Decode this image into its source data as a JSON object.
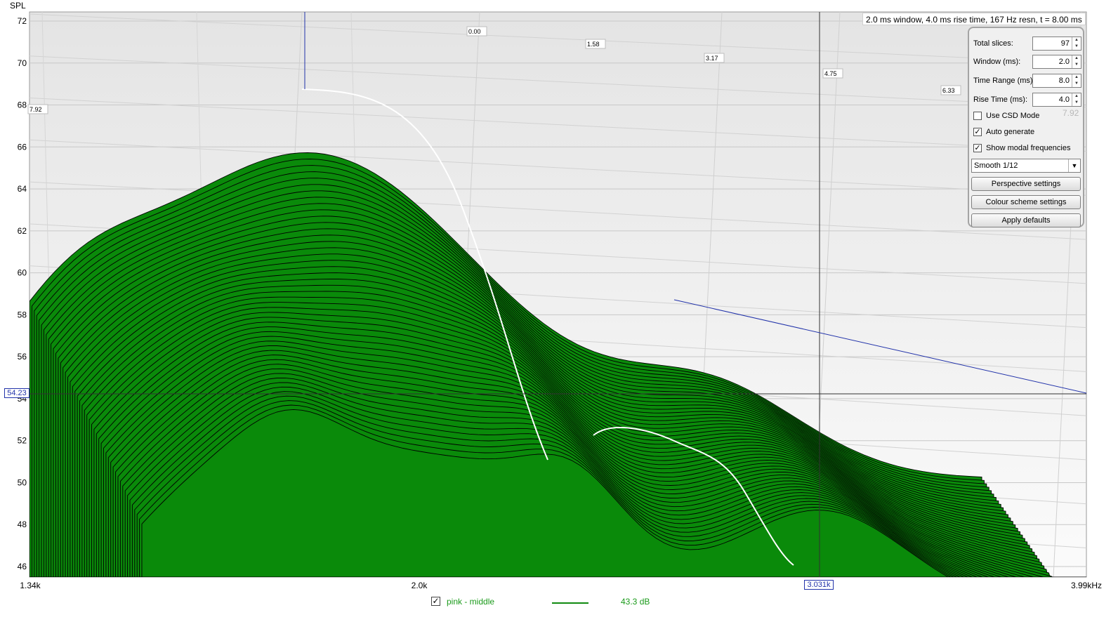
{
  "chart_data": {
    "type": "waterfall",
    "ylabel": "SPL",
    "y_ticks": [
      "72",
      "70",
      "68",
      "66",
      "64",
      "62",
      "60",
      "58",
      "56",
      "54",
      "52",
      "50",
      "48",
      "46"
    ],
    "x_ticks": [
      "1.34k",
      "2.0k",
      "3.99kHz"
    ],
    "time_labels": [
      "0.00",
      "1.58",
      "3.17",
      "4.75",
      "6.33",
      "7.92"
    ],
    "ylim": [
      45.4,
      72.6
    ],
    "xlim_hz": [
      1340,
      3990
    ],
    "scale": "log",
    "front_slice_peaks": [
      {
        "freq_hz": 1660,
        "spl": 68.7
      },
      {
        "freq_hz": 2750,
        "spl": 57.3
      }
    ],
    "ridge_peak": {
      "freq_hz": 1660,
      "spl": 68.7
    },
    "fill_color": "#0a8a0a",
    "line_color": "#000000",
    "highlight_color": "#ffffff"
  },
  "header": {
    "info": "2.0 ms window, 4.0 ms rise time,  167 Hz resn, t = 8.00 ms"
  },
  "cursor": {
    "y_value": "54.23",
    "x_value": "3.031k"
  },
  "panel": {
    "total_slices_label": "Total slices:",
    "total_slices_value": "97",
    "window_label": "Window (ms):",
    "window_value": "2.0",
    "time_range_label": "Time Range (ms):",
    "time_range_value": "8.0",
    "rise_time_label": "Rise Time (ms):",
    "rise_time_value": "4.0",
    "ghost_value": "7.92",
    "use_csd_label": "Use CSD Mode",
    "use_csd_checked": false,
    "auto_generate_label": "Auto generate",
    "auto_generate_checked": true,
    "show_modal_label": "Show modal frequencies",
    "show_modal_checked": true,
    "smooth_value": "Smooth 1/12",
    "perspective_button": "Perspective settings",
    "colour_button": "Colour scheme settings",
    "defaults_button": "Apply defaults"
  },
  "legend": {
    "name": "pink - middle",
    "value": "43.3 dB",
    "checked": true,
    "color": "#108a10"
  }
}
